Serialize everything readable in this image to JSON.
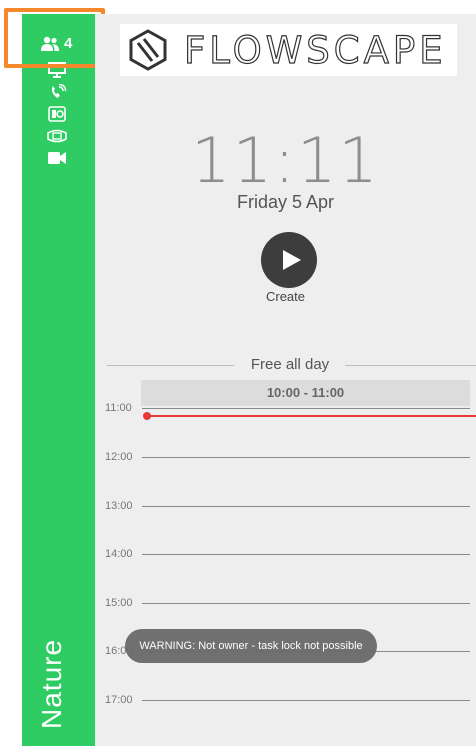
{
  "sidebar": {
    "occupancy_count": "4",
    "room_name": "Nature",
    "icons": [
      "display-icon",
      "phone-icon",
      "speaker-icon",
      "projector-icon",
      "video-camera-icon"
    ]
  },
  "header": {
    "brand": "FLOWSCAPE"
  },
  "clock": {
    "time": "11:11",
    "date": "Friday 5 Apr"
  },
  "create": {
    "label": "Create"
  },
  "schedule": {
    "status": "Free all day",
    "busy_block": "10:00 - 11:00",
    "hours": [
      "11:00",
      "12:00",
      "13:00",
      "14:00",
      "15:00",
      "16:00",
      "17:00"
    ]
  },
  "toast": {
    "message": "WARNING: Not owner - task lock not possible"
  },
  "colors": {
    "sidebar": "#2ecc62",
    "highlight": "#f5882a",
    "now_line": "#e53935",
    "create_button": "#3d3d3d"
  }
}
